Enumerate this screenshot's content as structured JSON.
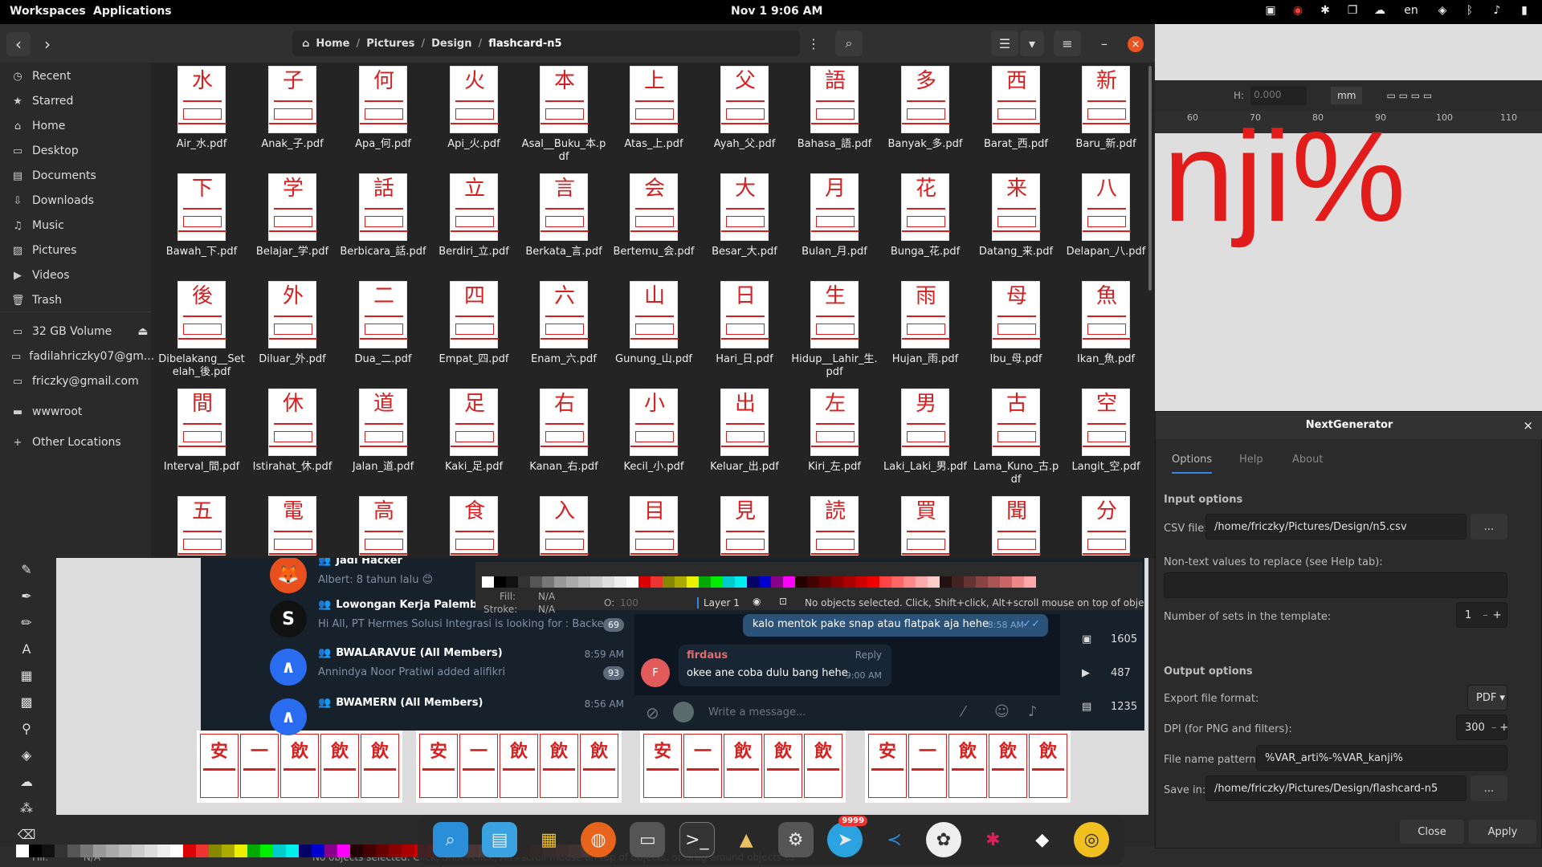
{
  "topbar": {
    "workspaces": "Workspaces",
    "applications": "Applications",
    "clock": "Nov 1  9:06 AM",
    "lang": "en"
  },
  "filemanager": {
    "path": [
      "Home",
      "Pictures",
      "Design",
      "flashcard-n5"
    ],
    "sidebar": [
      {
        "icon": "clock-icon",
        "label": "Recent"
      },
      {
        "icon": "star-icon",
        "label": "Starred"
      },
      {
        "icon": "home-icon",
        "label": "Home"
      },
      {
        "icon": "desktop-icon",
        "label": "Desktop"
      },
      {
        "icon": "document-icon",
        "label": "Documents"
      },
      {
        "icon": "download-icon",
        "label": "Downloads"
      },
      {
        "icon": "music-icon",
        "label": "Music"
      },
      {
        "icon": "picture-icon",
        "label": "Pictures"
      },
      {
        "icon": "video-icon",
        "label": "Videos"
      },
      {
        "icon": "trash-icon",
        "label": "Trash"
      },
      {
        "icon": "drive-icon",
        "label": "32 GB Volume"
      },
      {
        "icon": "drive-icon",
        "label": "fadilahriczky07@gm..."
      },
      {
        "icon": "drive-icon",
        "label": "friczky@gmail.com"
      },
      {
        "icon": "folder-icon",
        "label": "wwwroot"
      },
      {
        "icon": "plus-icon",
        "label": "Other Locations"
      }
    ],
    "files": [
      {
        "k": "水",
        "name": "Air_水.pdf"
      },
      {
        "k": "子",
        "name": "Anak_子.pdf"
      },
      {
        "k": "何",
        "name": "Apa_何.pdf"
      },
      {
        "k": "火",
        "name": "Api_火.pdf"
      },
      {
        "k": "本",
        "name": "Asal__Buku_本.pdf"
      },
      {
        "k": "上",
        "name": "Atas_上.pdf"
      },
      {
        "k": "父",
        "name": "Ayah_父.pdf"
      },
      {
        "k": "語",
        "name": "Bahasa_語.pdf"
      },
      {
        "k": "多",
        "name": "Banyak_多.pdf"
      },
      {
        "k": "西",
        "name": "Barat_西.pdf"
      },
      {
        "k": "新",
        "name": "Baru_新.pdf"
      },
      {
        "k": "下",
        "name": "Bawah_下.pdf"
      },
      {
        "k": "学",
        "name": "Belajar_学.pdf"
      },
      {
        "k": "話",
        "name": "Berbicara_話.pdf"
      },
      {
        "k": "立",
        "name": "Berdiri_立.pdf"
      },
      {
        "k": "言",
        "name": "Berkata_言.pdf"
      },
      {
        "k": "会",
        "name": "Bertemu_会.pdf"
      },
      {
        "k": "大",
        "name": "Besar_大.pdf"
      },
      {
        "k": "月",
        "name": "Bulan_月.pdf"
      },
      {
        "k": "花",
        "name": "Bunga_花.pdf"
      },
      {
        "k": "来",
        "name": "Datang_来.pdf"
      },
      {
        "k": "八",
        "name": "Delapan_八.pdf"
      },
      {
        "k": "後",
        "name": "Dibelakang__Setelah_後.pdf"
      },
      {
        "k": "外",
        "name": "Diluar_外.pdf"
      },
      {
        "k": "二",
        "name": "Dua_二.pdf"
      },
      {
        "k": "四",
        "name": "Empat_四.pdf"
      },
      {
        "k": "六",
        "name": "Enam_六.pdf"
      },
      {
        "k": "山",
        "name": "Gunung_山.pdf"
      },
      {
        "k": "日",
        "name": "Hari_日.pdf"
      },
      {
        "k": "生",
        "name": "Hidup__Lahir_生.pdf"
      },
      {
        "k": "雨",
        "name": "Hujan_雨.pdf"
      },
      {
        "k": "母",
        "name": "Ibu_母.pdf"
      },
      {
        "k": "魚",
        "name": "Ikan_魚.pdf"
      },
      {
        "k": "間",
        "name": "Interval_間.pdf"
      },
      {
        "k": "休",
        "name": "Istirahat_休.pdf"
      },
      {
        "k": "道",
        "name": "Jalan_道.pdf"
      },
      {
        "k": "足",
        "name": "Kaki_足.pdf"
      },
      {
        "k": "右",
        "name": "Kanan_右.pdf"
      },
      {
        "k": "小",
        "name": "Kecil_小.pdf"
      },
      {
        "k": "出",
        "name": "Keluar_出.pdf"
      },
      {
        "k": "左",
        "name": "Kiri_左.pdf"
      },
      {
        "k": "男",
        "name": "Laki_Laki_男.pdf"
      },
      {
        "k": "古",
        "name": "Lama_Kuno_古.pdf"
      },
      {
        "k": "空",
        "name": "Langit_空.pdf"
      },
      {
        "k": "五",
        "name": ""
      },
      {
        "k": "電",
        "name": ""
      },
      {
        "k": "高",
        "name": ""
      },
      {
        "k": "食",
        "name": ""
      },
      {
        "k": "入",
        "name": ""
      },
      {
        "k": "目",
        "name": ""
      },
      {
        "k": "見",
        "name": ""
      },
      {
        "k": "読",
        "name": ""
      },
      {
        "k": "買",
        "name": ""
      },
      {
        "k": "聞",
        "name": ""
      },
      {
        "k": "分",
        "name": ""
      }
    ]
  },
  "nextgen": {
    "title": "NextGenerator",
    "tabs": [
      "Options",
      "Help",
      "About"
    ],
    "input_options": "Input options",
    "csv_label": "CSV file:",
    "csv_value": "/home/friczky/Pictures/Design/n5.csv",
    "browse": "...",
    "nontext_label": "Non-text values to replace (see Help tab):",
    "sets_label": "Number of sets in the template:",
    "sets_value": "1",
    "output_options": "Output options",
    "format_label": "Export file format:",
    "format_value": "PDF",
    "dpi_label": "DPI (for PNG and filters):",
    "dpi_value": "300",
    "pattern_label": "File name pattern:",
    "pattern_value": "%VAR_arti%-%VAR_kanji%",
    "savein_label": "Save in:",
    "savein_value": "/home/friczky/Pictures/Design/flashcard-n5",
    "close": "Close",
    "apply": "Apply"
  },
  "telegram": {
    "chats": [
      {
        "name": "Jadi Hacker",
        "msg": "Albert: 8 tahun lalu 😊",
        "time": "",
        "badge": "",
        "color": "#e8501e",
        "letter": "🦊"
      },
      {
        "name": "Lowongan Kerja Palembang",
        "msg": "Hi All,   PT Hermes Solusi Integrasi is looking for : Backe...",
        "time": "",
        "badge": "69",
        "color": "#111111",
        "letter": "S"
      },
      {
        "name": "BWALARAVUE (All Members)",
        "msg": "Annindya Noor Pratiwi added alifikri",
        "time": "8:59 AM",
        "badge": "93",
        "color": "#2a6cf0",
        "letter": "∧"
      },
      {
        "name": "BWAMERN (All Members)",
        "msg": "",
        "time": "8:56 AM",
        "badge": "",
        "color": "#2a6cf0",
        "letter": "∧"
      }
    ],
    "bubble": "kalo mentok pake snap atau flatpak aja hehe",
    "bubble_time": "8:58 AM",
    "reply_name": "firdaus",
    "reply_label": "Reply",
    "reply_text": "okee ane coba dulu bang hehe",
    "reply_time": "9:00 AM",
    "avatar_letter": "F",
    "input_placeholder": "Write a message...",
    "side": [
      "1605",
      "487",
      "1235"
    ]
  },
  "inkscape": {
    "fill": "Fill:",
    "fill_value": "N/A",
    "stroke": "Stroke:",
    "stroke_value": "N/A",
    "opacity_label": "O:",
    "opacity_value": "100",
    "layer": "Layer 1",
    "status": "No objects selected. Click, Shift+click, Alt+scroll mouse on top of obje",
    "status2": "No objects selected. Click, Shift+click, Alt+scroll mouse on top of objects, or drag around objects to",
    "h_label": "H:",
    "h_value": "0.000",
    "unit": "mm",
    "ruler": [
      "60",
      "70",
      "80",
      "90",
      "100",
      "110"
    ],
    "bigtext": "nji%",
    "bottom_fill": "Fill:",
    "bottom_value": "N/A",
    "canvas_kanji": [
      "安",
      "一",
      "飲",
      "飲",
      "飲"
    ]
  },
  "dock": {
    "badge": "9999"
  }
}
